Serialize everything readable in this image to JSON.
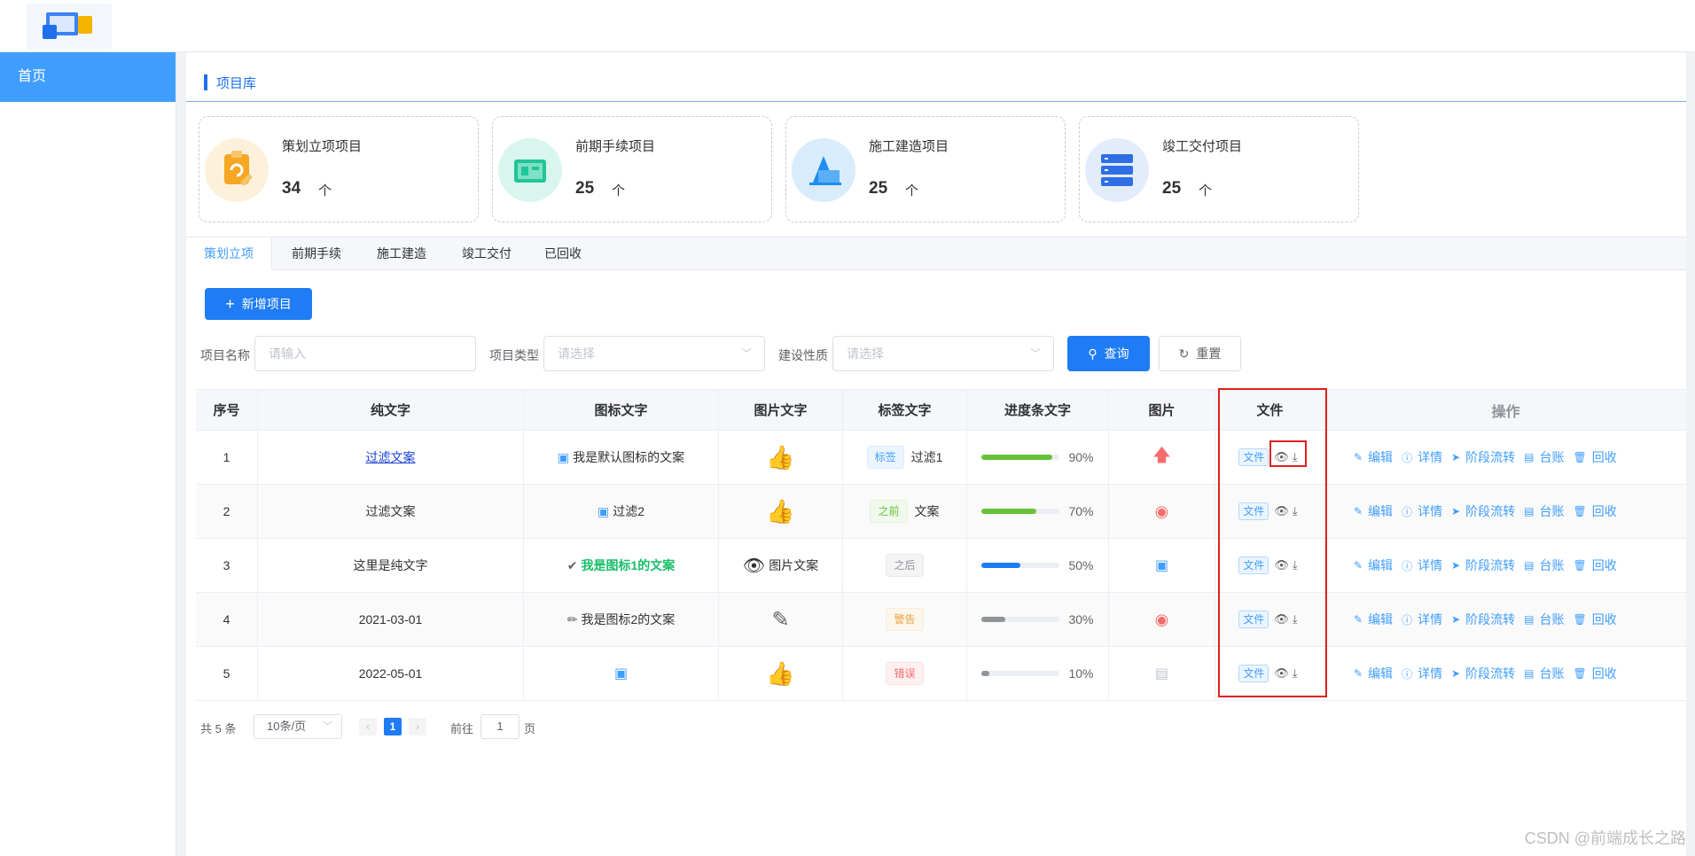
{
  "header": {
    "logo": "app-logo"
  },
  "sidebar": {
    "home_label": "首页"
  },
  "section": {
    "title": "项目库"
  },
  "stats": [
    {
      "title": "策划立项项目",
      "count": "34",
      "unit": "个",
      "icon": "clipboard-icon",
      "color": "#f5a623"
    },
    {
      "title": "前期手续项目",
      "count": "25",
      "unit": "个",
      "icon": "blueprint-icon",
      "color": "#21c59a"
    },
    {
      "title": "施工建造项目",
      "count": "25",
      "unit": "个",
      "icon": "building-icon",
      "color": "#1e8cf0"
    },
    {
      "title": "竣工交付项目",
      "count": "25",
      "unit": "个",
      "icon": "server-icon",
      "color": "#2f6fe5"
    }
  ],
  "tabs": [
    "策划立项",
    "前期手续",
    "施工建造",
    "竣工交付",
    "已回收"
  ],
  "active_tab": "策划立项",
  "toolbar": {
    "add_label": "新增项目"
  },
  "filters": {
    "name_label": "项目名称",
    "name_placeholder": "请输入",
    "type_label": "项目类型",
    "type_placeholder": "请选择",
    "nature_label": "建设性质",
    "nature_placeholder": "请选择",
    "query_label": "查询",
    "reset_label": "重置"
  },
  "table": {
    "headers": [
      "序号",
      "纯文字",
      "图标文字",
      "图片文字",
      "标签文字",
      "进度条文字",
      "图片",
      "文件",
      "操作"
    ],
    "file_tag": "文件",
    "ops": [
      "编辑",
      "详情",
      "阶段流转",
      "台账",
      "回收"
    ],
    "rows": [
      {
        "index": "1",
        "text": "过滤文案",
        "icon_text": "我是默认图标的文案",
        "img_text": "",
        "tag": "标签",
        "tag_suffix": "过滤1",
        "progress": 90,
        "progress_text": "90%",
        "progress_color": "#67c23a"
      },
      {
        "index": "2",
        "text": "过滤文案",
        "icon_text": "过滤2",
        "img_text": "",
        "tag": "之前",
        "tag_suffix": "文案",
        "progress": 70,
        "progress_text": "70%",
        "progress_color": "#67c23a"
      },
      {
        "index": "3",
        "text": "这里是纯文字",
        "icon_text": "我是图标1的文案",
        "img_text": "图片文案",
        "tag": "之后",
        "tag_suffix": "",
        "progress": 50,
        "progress_text": "50%",
        "progress_color": "#1f7cf5"
      },
      {
        "index": "4",
        "text": "2021-03-01",
        "icon_text": "我是图标2的文案",
        "img_text": "",
        "tag": "警告",
        "tag_suffix": "",
        "progress": 30,
        "progress_text": "30%",
        "progress_color": "#909399"
      },
      {
        "index": "5",
        "text": "2022-05-01",
        "icon_text": "",
        "img_text": "",
        "tag": "错误",
        "tag_suffix": "",
        "progress": 10,
        "progress_text": "10%",
        "progress_color": "#909399"
      }
    ]
  },
  "pagination": {
    "total": "共 5 条",
    "size": "10条/页",
    "current": "1",
    "goto_label": "前往",
    "goto_value": "1",
    "page_label": "页"
  },
  "watermark": "CSDN @前端成长之路"
}
